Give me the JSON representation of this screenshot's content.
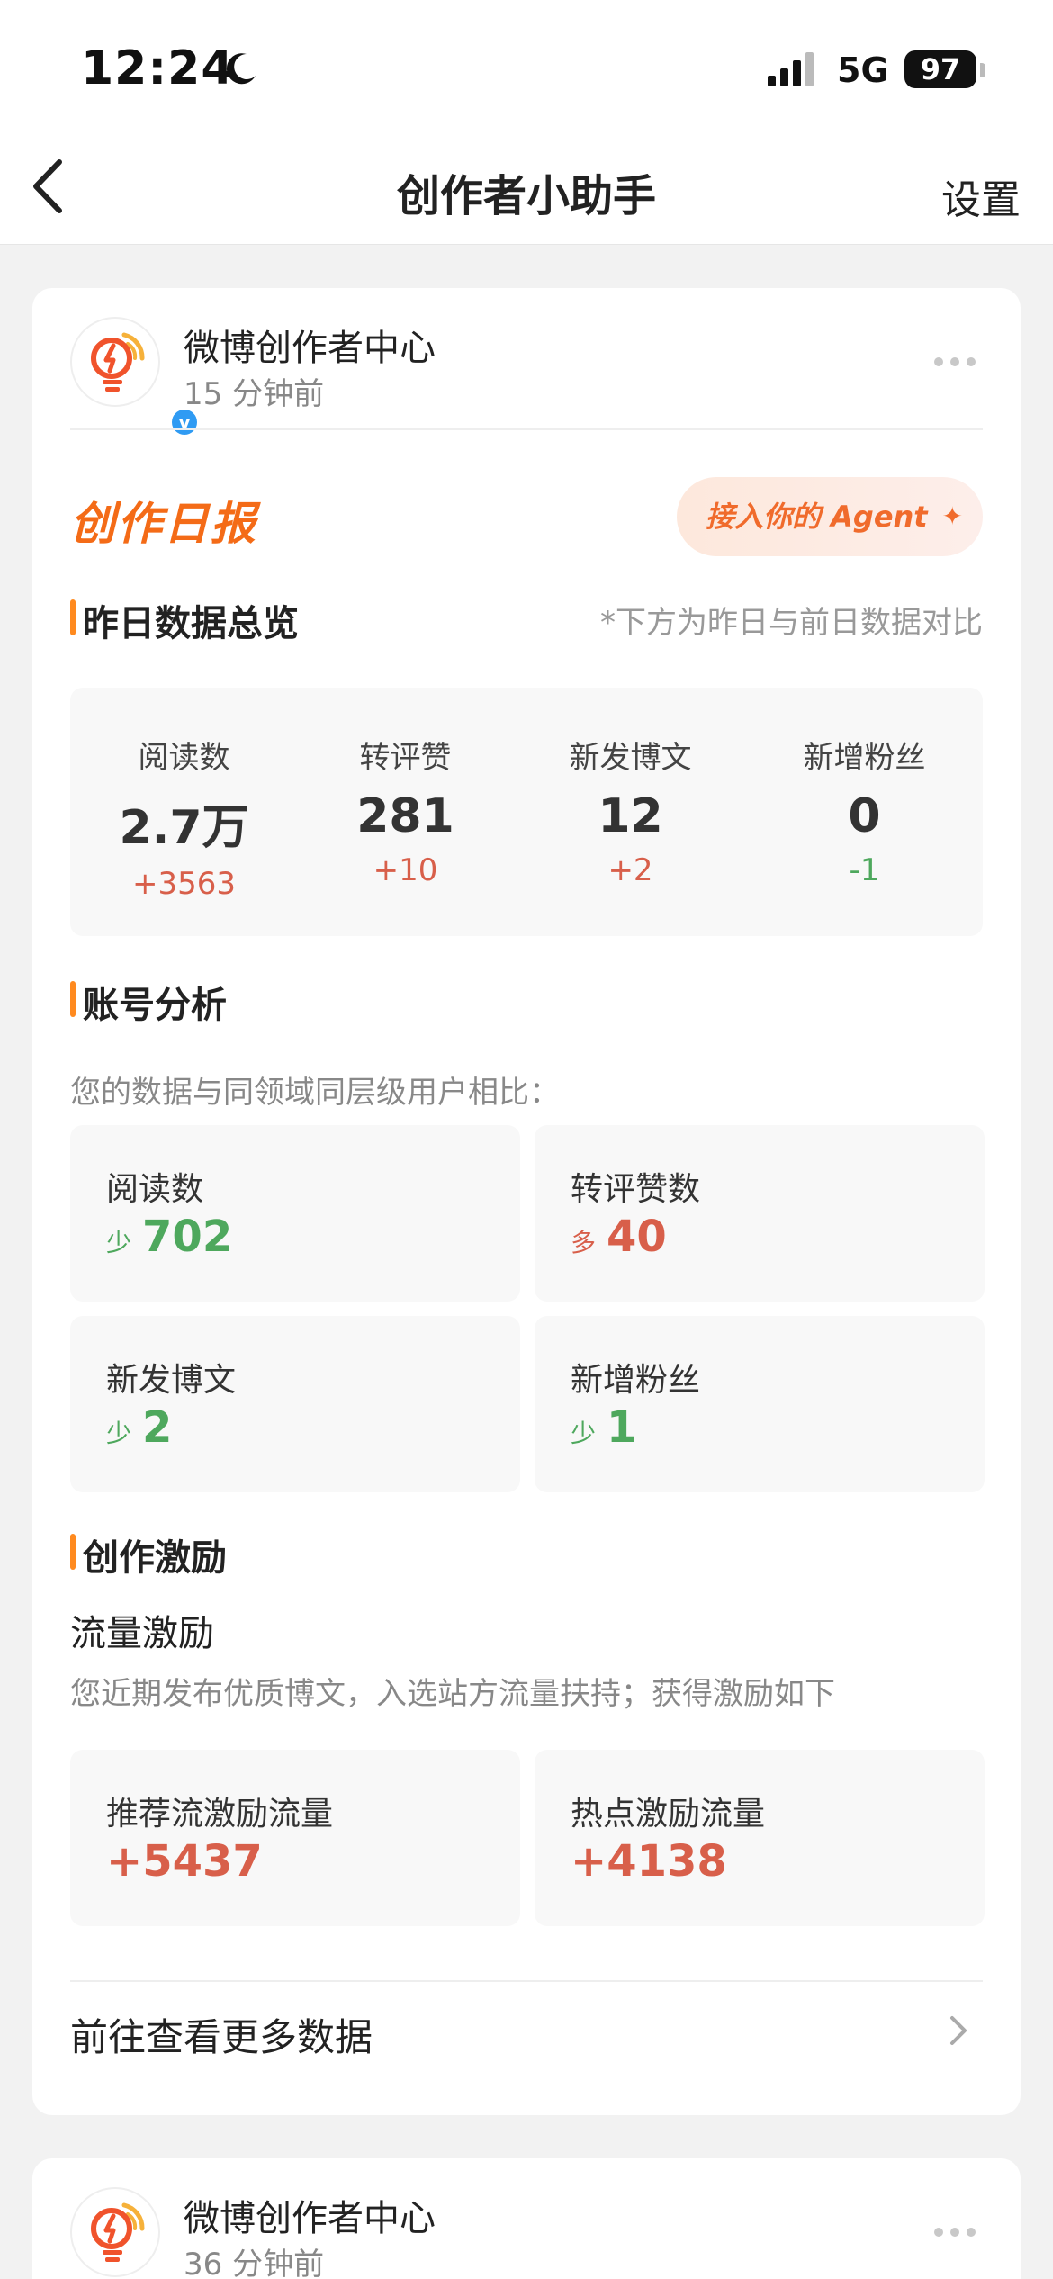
{
  "status_bar": {
    "time": "12:24",
    "network": "5G",
    "battery": "97"
  },
  "nav": {
    "title": "创作者小助手",
    "settings": "设置"
  },
  "card": {
    "account_name": "微博创作者中心",
    "time_ago": "15 分钟前",
    "report_title": "创作日报",
    "agent_button": "接入你的 Agent",
    "overview": {
      "title": "昨日数据总览",
      "note": "*下方为昨日与前日数据对比",
      "items": [
        {
          "label": "阅读数",
          "value": "2.7万",
          "delta": "+3563",
          "trend": "up"
        },
        {
          "label": "转评赞",
          "value": "281",
          "delta": "+10",
          "trend": "up"
        },
        {
          "label": "新发博文",
          "value": "12",
          "delta": "+2",
          "trend": "up"
        },
        {
          "label": "新增粉丝",
          "value": "0",
          "delta": "-1",
          "trend": "down"
        }
      ]
    },
    "analysis": {
      "title": "账号分析",
      "note": "您的数据与同领域同层级用户相比：",
      "tiles": [
        {
          "label": "阅读数",
          "tag": "少",
          "value": "702",
          "trend": "down"
        },
        {
          "label": "转评赞数",
          "tag": "多",
          "value": "40",
          "trend": "up"
        },
        {
          "label": "新发博文",
          "tag": "少",
          "value": "2",
          "trend": "down"
        },
        {
          "label": "新增粉丝",
          "tag": "少",
          "value": "1",
          "trend": "down"
        }
      ]
    },
    "incentive": {
      "title": "创作激励",
      "subtitle": "流量激励",
      "note": "您近期发布优质博文，入选站方流量扶持；获得激励如下",
      "tiles": [
        {
          "label": "推荐流激励流量",
          "value": "+5437"
        },
        {
          "label": "热点激励流量",
          "value": "+4138"
        }
      ]
    },
    "more_link": "前往查看更多数据"
  },
  "card2": {
    "account_name": "微博创作者中心",
    "time_ago": "36 分钟前"
  },
  "colors": {
    "accent": "#f46b17",
    "up": "#d85f4a",
    "down": "#4ea85d",
    "bar": "#ff8a1f"
  }
}
